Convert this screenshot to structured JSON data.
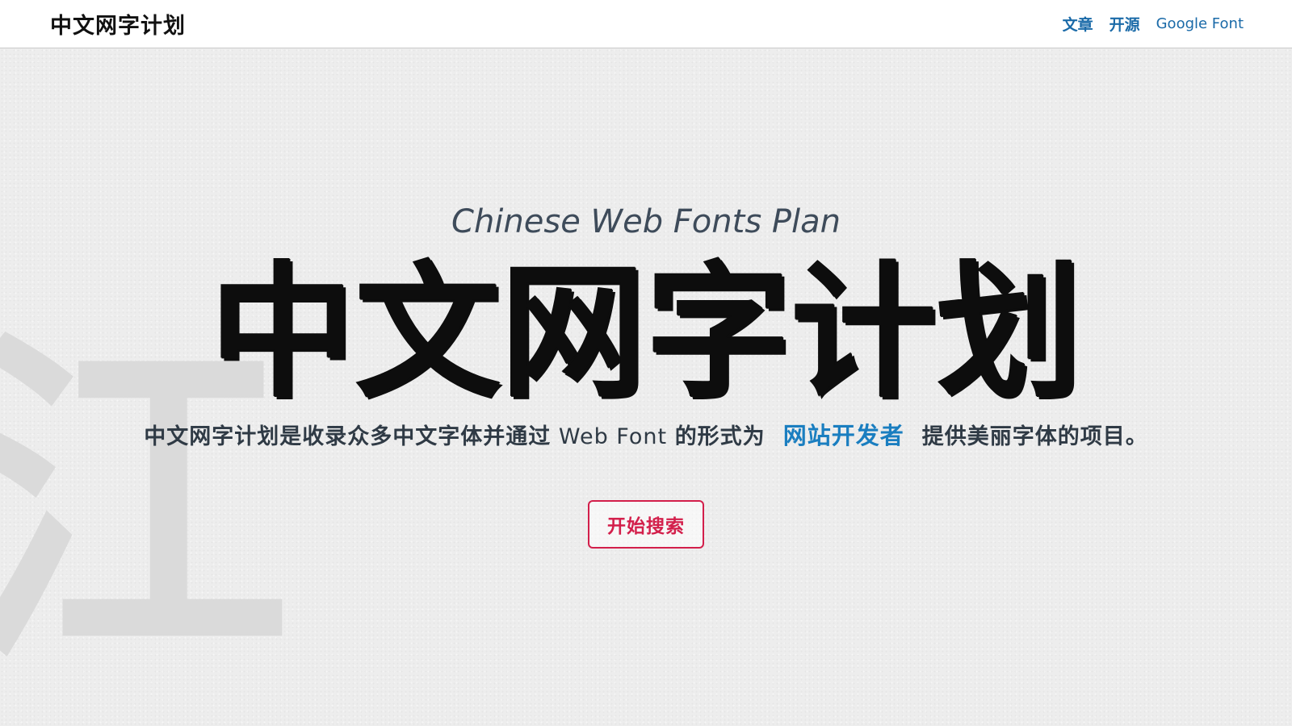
{
  "navbar": {
    "brand": "中文网字计划",
    "links": [
      {
        "label": "文章"
      },
      {
        "label": "开源"
      },
      {
        "label": "Google Font"
      }
    ]
  },
  "background_char": "江",
  "hero": {
    "subtitle": "Chinese Web Fonts Plan",
    "title": "中文网字计划",
    "description": {
      "before": "中文网字计划是收录众多中文字体并通过",
      "web_font": " Web Font ",
      "middle": "的形式为",
      "highlight": "网站开发者",
      "after": "提供美丽字体的项目。"
    },
    "button_label": "开始搜索"
  },
  "colors": {
    "link": "#1a6aa8",
    "highlight": "#1a7ec0",
    "button": "#d31f4b",
    "title": "#0d0d0d",
    "background": "#ededed"
  }
}
